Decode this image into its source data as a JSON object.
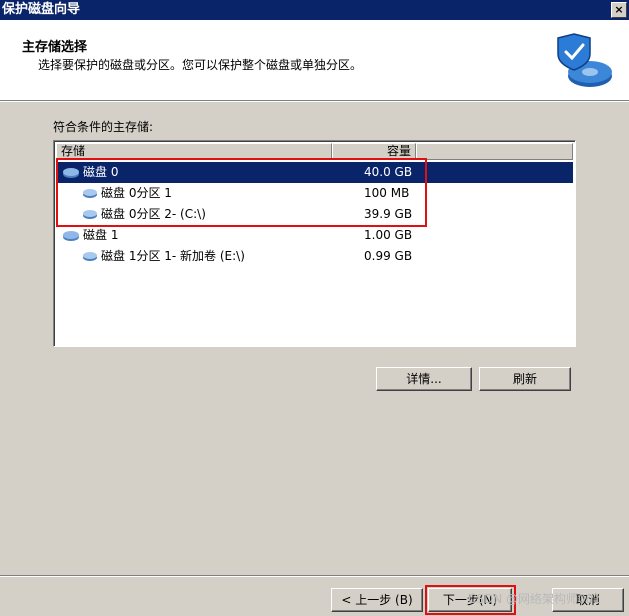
{
  "window": {
    "title": "保护磁盘向导",
    "close_label": "×"
  },
  "header": {
    "title": "主存储选择",
    "subtitle": "选择要保护的磁盘或分区。您可以保护整个磁盘或单独分区。",
    "icon": "shield-disk-icon"
  },
  "list": {
    "label": "符合条件的主存储:",
    "columns": {
      "storage": "存储",
      "capacity": "容量"
    },
    "rows": [
      {
        "name": "磁盘 0",
        "size": "40.0 GB",
        "level": 0,
        "selected": true
      },
      {
        "name": "磁盘 0分区 1",
        "size": "100 MB",
        "level": 1,
        "selected": false
      },
      {
        "name": "磁盘 0分区 2- (C:\\)",
        "size": "39.9 GB",
        "level": 1,
        "selected": false
      },
      {
        "name": "磁盘 1",
        "size": "1.00 GB",
        "level": 0,
        "selected": false
      },
      {
        "name": "磁盘 1分区 1- 新加卷 (E:\\)",
        "size": "0.99 GB",
        "level": 1,
        "selected": false
      }
    ]
  },
  "buttons": {
    "details": "详情...",
    "refresh": "刷新",
    "back": "< 上一步 (B)",
    "next": "下一步(N)",
    "cancel": "取消"
  },
  "watermark": "CSDN @网络架构师001",
  "colors": {
    "title_bar": "#0a246a",
    "selection": "#0a246a",
    "highlight_box": "#e01010",
    "face": "#d4d0c8"
  }
}
